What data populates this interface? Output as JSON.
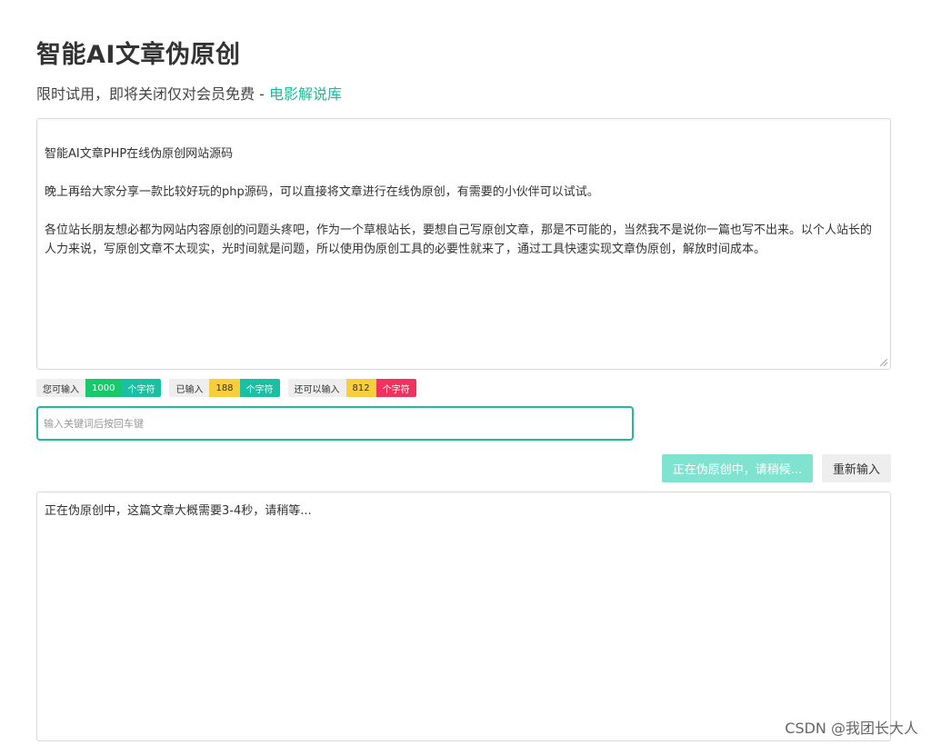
{
  "header": {
    "title": "智能AI文章伪原创",
    "subtitle_prefix": "限时试用，即将关闭仅对会员免费 - ",
    "subtitle_link": "电影解说库"
  },
  "input": {
    "paragraphs": [
      "智能AI文章PHP在线伪原创网站源码",
      "晚上再给大家分享一款比较好玩的php源码，可以直接将文章进行在线伪原创，有需要的小伙伴可以试试。",
      "各位站长朋友想必都为网站内容原创的问题头疼吧，作为一个草根站长，要想自己写原创文章，那是不可能的，当然我不是说你一篇也写不出来。以个人站长的人力来说，写原创文章不太现实，光时间就是问题，所以使用伪原创工具的必要性就来了，通过工具快速实现文章伪原创，解放时间成本。"
    ]
  },
  "counters": {
    "allowed_label": "您可输入",
    "allowed_value": "1000",
    "entered_label": "已输入",
    "entered_value": "188",
    "remaining_label": "还可以输入",
    "remaining_value": "812",
    "unit": "个字符"
  },
  "keyword": {
    "placeholder": "输入关键词后按回车键",
    "value": ""
  },
  "buttons": {
    "process": "正在伪原创中，请稍候...",
    "reset": "重新输入"
  },
  "output": {
    "text": "正在伪原创中，这篇文章大概需要3-4秒，请稍等..."
  },
  "watermark": "CSDN @我团长大人",
  "colors": {
    "accent": "#1bbc9b",
    "green": "#18c86a",
    "yellow": "#f8cd3e",
    "red": "#f0325f",
    "button_disabled": "#7fe3d0"
  }
}
